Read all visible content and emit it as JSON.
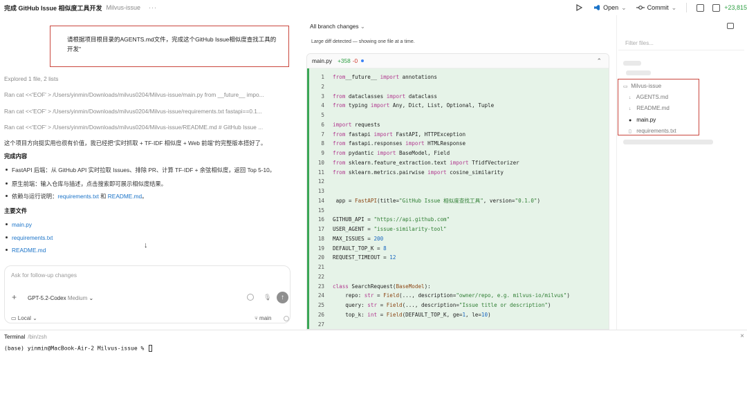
{
  "titlebar": {
    "title": "完成 GitHub Issue 相似度工具开发",
    "project": "Milvus-issue",
    "more": "···",
    "run_icon": "play-icon",
    "open_label": "Open",
    "commit_label": "Commit",
    "stat_add": "+23,815"
  },
  "chat": {
    "user_message": "请根据项目根目录的AGENTS.md文件，完成这个GitHub Issue相似度查找工具的开发\"",
    "explored": "Explored 1 file, 2 lists",
    "ran_1": "Ran cat <<'EOF' > /Users/yinmin/Downloads/milvus0204/Milvus-issue/main.py from __future__ impo...",
    "ran_2": "Ran cat <<'EOF' > /Users/yinmin/Downloads/milvus0204/Milvus-issue/requirements.txt fastapi==0.1...",
    "ran_3": "Ran cat <<'EOF' > /Users/yinmin/Downloads/milvus0204/Milvus-issue/README.md # GitHub Issue ...",
    "summary": "这个项目方向挺实用也很有价值，我已经把“实时抓取 + TF-IDF 相似度 + Web 前端”的完整版本搭好了。",
    "done_heading": "完成内容",
    "done_items": [
      "FastAPI 后端：从 GitHub API 实时拉取 Issues、排除 PR、计算 TF-IDF + 余弦相似度，返回 Top 5-10。",
      "原生前端：输入仓库与描述，点击搜索即可展示相似度结果。"
    ],
    "deps_prefix": "依赖与运行说明：",
    "deps_link1": "requirements.txt",
    "deps_and": " 和 ",
    "deps_link2": "README.md",
    "deps_suffix": "。",
    "files_heading": "主要文件",
    "files": [
      "main.py",
      "requirements.txt",
      "README.md"
    ]
  },
  "composer": {
    "placeholder": "Ask for follow-up changes",
    "model": "GPT-5.2-Codex",
    "effort": "Medium",
    "env": "Local",
    "branch": "main"
  },
  "diff": {
    "header": "All branch changes",
    "note": "Large diff detected — showing one file at a time.",
    "file_name": "main.py",
    "added": "+358",
    "removed": "-0",
    "lines": [
      {
        "n": "1",
        "code": [
          [
            "kw",
            "from"
          ],
          [
            "",
            "__future__ "
          ],
          [
            "kw",
            "import"
          ],
          [
            "",
            " annotations"
          ]
        ]
      },
      {
        "n": "2",
        "code": []
      },
      {
        "n": "3",
        "code": [
          [
            "kw",
            "from"
          ],
          [
            "",
            " dataclasses "
          ],
          [
            "kw",
            "import"
          ],
          [
            "",
            " dataclass"
          ]
        ]
      },
      {
        "n": "4",
        "code": [
          [
            "kw",
            "from"
          ],
          [
            "",
            " typing "
          ],
          [
            "kw",
            "import"
          ],
          [
            "",
            " Any, Dict, List, Optional, Tuple"
          ]
        ]
      },
      {
        "n": "5",
        "code": []
      },
      {
        "n": "6",
        "code": [
          [
            "kw",
            "import"
          ],
          [
            "",
            " requests"
          ]
        ]
      },
      {
        "n": "7",
        "code": [
          [
            "kw",
            "from"
          ],
          [
            "",
            " fastapi "
          ],
          [
            "kw",
            "import"
          ],
          [
            "",
            " FastAPI, HTTPException"
          ]
        ]
      },
      {
        "n": "8",
        "code": [
          [
            "kw",
            "from"
          ],
          [
            "",
            " fastapi.responses "
          ],
          [
            "kw",
            "import"
          ],
          [
            "",
            " HTMLResponse"
          ]
        ]
      },
      {
        "n": "9",
        "code": [
          [
            "kw",
            "from"
          ],
          [
            "",
            " pydantic "
          ],
          [
            "kw",
            "import"
          ],
          [
            "",
            " BaseModel, Field"
          ]
        ]
      },
      {
        "n": "10",
        "code": [
          [
            "kw",
            "from"
          ],
          [
            "",
            " sklearn.feature_extraction.text "
          ],
          [
            "kw",
            "import"
          ],
          [
            "",
            " TfidfVectorizer"
          ]
        ]
      },
      {
        "n": "11",
        "code": [
          [
            "kw",
            "from"
          ],
          [
            "",
            " sklearn.metrics.pairwise "
          ],
          [
            "kw",
            "import"
          ],
          [
            "",
            " cosine_similarity"
          ]
        ]
      },
      {
        "n": "12",
        "code": []
      },
      {
        "n": "13",
        "code": []
      },
      {
        "n": "14",
        "code": [
          [
            "",
            " app = "
          ],
          [
            "cls",
            "FastAPI"
          ],
          [
            "",
            "(title="
          ],
          [
            "str",
            "\"GitHub Issue 相似度查找工具\""
          ],
          [
            "",
            ", version="
          ],
          [
            "str",
            "\"0.1.0\""
          ],
          [
            "",
            ")"
          ]
        ]
      },
      {
        "n": "15",
        "code": []
      },
      {
        "n": "16",
        "code": [
          [
            "",
            "GITHUB_API = "
          ],
          [
            "str",
            "\"https://api.github.com\""
          ]
        ]
      },
      {
        "n": "17",
        "code": [
          [
            "",
            "USER_AGENT = "
          ],
          [
            "str",
            "\"issue-similarity-tool\""
          ]
        ]
      },
      {
        "n": "18",
        "code": [
          [
            "",
            "MAX_ISSUES = "
          ],
          [
            "num",
            "200"
          ]
        ]
      },
      {
        "n": "19",
        "code": [
          [
            "",
            "DEFAULT_TOP_K = "
          ],
          [
            "num",
            "8"
          ]
        ]
      },
      {
        "n": "20",
        "code": [
          [
            "",
            "REQUEST_TIMEOUT = "
          ],
          [
            "num",
            "12"
          ]
        ]
      },
      {
        "n": "21",
        "code": []
      },
      {
        "n": "22",
        "code": []
      },
      {
        "n": "23",
        "code": [
          [
            "kw",
            "class"
          ],
          [
            "",
            " SearchRequest("
          ],
          [
            "cls",
            "BaseModel"
          ],
          [
            "",
            "):"
          ]
        ]
      },
      {
        "n": "24",
        "code": [
          [
            "",
            "    repo: "
          ],
          [
            "kw",
            "str"
          ],
          [
            "",
            " = "
          ],
          [
            "cls",
            "Field"
          ],
          [
            "",
            "(..., description="
          ],
          [
            "str",
            "\"owner/repo, e.g. milvus-io/milvus\""
          ],
          [
            "",
            ")"
          ]
        ]
      },
      {
        "n": "25",
        "code": [
          [
            "",
            "    query: "
          ],
          [
            "kw",
            "str"
          ],
          [
            "",
            " = "
          ],
          [
            "cls",
            "Field"
          ],
          [
            "",
            "(..., description="
          ],
          [
            "str",
            "\"Issue title or description\""
          ],
          [
            "",
            ")"
          ]
        ]
      },
      {
        "n": "26",
        "code": [
          [
            "",
            "    top_k: "
          ],
          [
            "kw",
            "int"
          ],
          [
            "",
            " = "
          ],
          [
            "cls",
            "Field"
          ],
          [
            "",
            "(DEFAULT_TOP_K, ge="
          ],
          [
            "num",
            "1"
          ],
          [
            "",
            ", le="
          ],
          [
            "num",
            "10"
          ],
          [
            "",
            ")"
          ]
        ]
      },
      {
        "n": "27",
        "code": []
      }
    ]
  },
  "tree": {
    "filter_placeholder": "Filter files...",
    "folder": "Milvus-issue",
    "files": [
      {
        "name": "AGENTS.md",
        "icon": "download-icon",
        "active": false
      },
      {
        "name": "README.md",
        "icon": "download-icon",
        "active": false
      },
      {
        "name": "main.py",
        "icon": "python-icon",
        "active": true
      },
      {
        "name": "requirements.txt",
        "icon": "file-icon",
        "active": false
      }
    ]
  },
  "terminal": {
    "title": "Terminal",
    "shell": "/bin/zsh",
    "prompt": "(base) yinmin@MacBook-Air-2 Milvus-issue % "
  }
}
